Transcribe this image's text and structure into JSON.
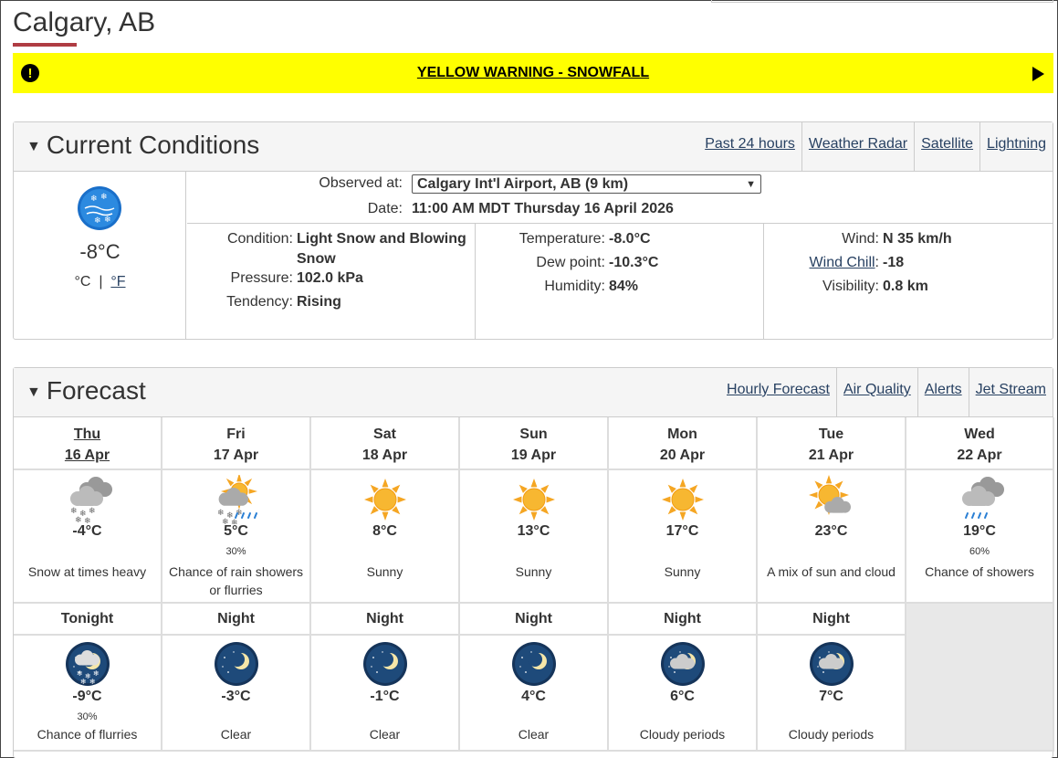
{
  "page": {
    "city": "Calgary, AB"
  },
  "warning": {
    "text": "YELLOW WARNING - SNOWFALL",
    "color": "#ffff00"
  },
  "current": {
    "title": "Current Conditions",
    "links": [
      "Past 24 hours",
      "Weather Radar",
      "Satellite",
      "Lightning"
    ],
    "icon": "snow-blowing-icon",
    "temp": "-8°C",
    "unit_c": "°C",
    "unit_f": "°F",
    "observed_label": "Observed at:",
    "station": "Calgary Int'l Airport, AB (9 km)",
    "date_label": "Date:",
    "date": "11:00 AM MDT Thursday 16 April 2026",
    "condition_label": "Condition:",
    "condition": "Light Snow and Blowing Snow",
    "pressure_label": "Pressure:",
    "pressure": "102.0 kPa",
    "tendency_label": "Tendency:",
    "tendency": "Rising",
    "temperature_label": "Temperature:",
    "temperature": "-8.0°C",
    "dewpoint_label": "Dew point:",
    "dewpoint": "-10.3°C",
    "humidity_label": "Humidity:",
    "humidity": "84%",
    "wind_label": "Wind:",
    "wind": "N 35 km/h",
    "windchill_label": "Wind Chill",
    "windchill": "-18",
    "visibility_label": "Visibility:",
    "visibility": "0.8 km"
  },
  "forecast": {
    "title": "Forecast",
    "links": [
      "Hourly Forecast",
      "Air Quality",
      "Alerts",
      "Jet Stream"
    ],
    "days": [
      {
        "day": "Thu",
        "date": "16 Apr",
        "temp": "-4°C",
        "pop": "",
        "summary": "Snow at times heavy",
        "icon": "snow-cloud-icon"
      },
      {
        "day": "Fri",
        "date": "17 Apr",
        "temp": "5°C",
        "pop": "30%",
        "summary": "Chance of rain showers or flurries",
        "icon": "sun-rain-snow-icon"
      },
      {
        "day": "Sat",
        "date": "18 Apr",
        "temp": "8°C",
        "pop": "",
        "summary": "Sunny",
        "icon": "sun-icon"
      },
      {
        "day": "Sun",
        "date": "19 Apr",
        "temp": "13°C",
        "pop": "",
        "summary": "Sunny",
        "icon": "sun-icon"
      },
      {
        "day": "Mon",
        "date": "20 Apr",
        "temp": "17°C",
        "pop": "",
        "summary": "Sunny",
        "icon": "sun-icon"
      },
      {
        "day": "Tue",
        "date": "21 Apr",
        "temp": "23°C",
        "pop": "",
        "summary": "A mix of sun and cloud",
        "icon": "sun-cloud-icon"
      },
      {
        "day": "Wed",
        "date": "22 Apr",
        "temp": "19°C",
        "pop": "60%",
        "summary": "Chance of showers",
        "icon": "rain-cloud-icon"
      }
    ],
    "nights": [
      {
        "label": "Tonight",
        "temp": "-9°C",
        "pop": "30%",
        "summary": "Chance of flurries",
        "icon": "night-flurries-icon"
      },
      {
        "label": "Night",
        "temp": "-3°C",
        "pop": "",
        "summary": "Clear",
        "icon": "moon-clear-icon"
      },
      {
        "label": "Night",
        "temp": "-1°C",
        "pop": "",
        "summary": "Clear",
        "icon": "moon-clear-icon"
      },
      {
        "label": "Night",
        "temp": "4°C",
        "pop": "",
        "summary": "Clear",
        "icon": "moon-clear-icon"
      },
      {
        "label": "Night",
        "temp": "6°C",
        "pop": "",
        "summary": "Cloudy periods",
        "icon": "moon-cloud-icon"
      },
      {
        "label": "Night",
        "temp": "7°C",
        "pop": "",
        "summary": "Cloudy periods",
        "icon": "moon-cloud-icon"
      }
    ]
  }
}
